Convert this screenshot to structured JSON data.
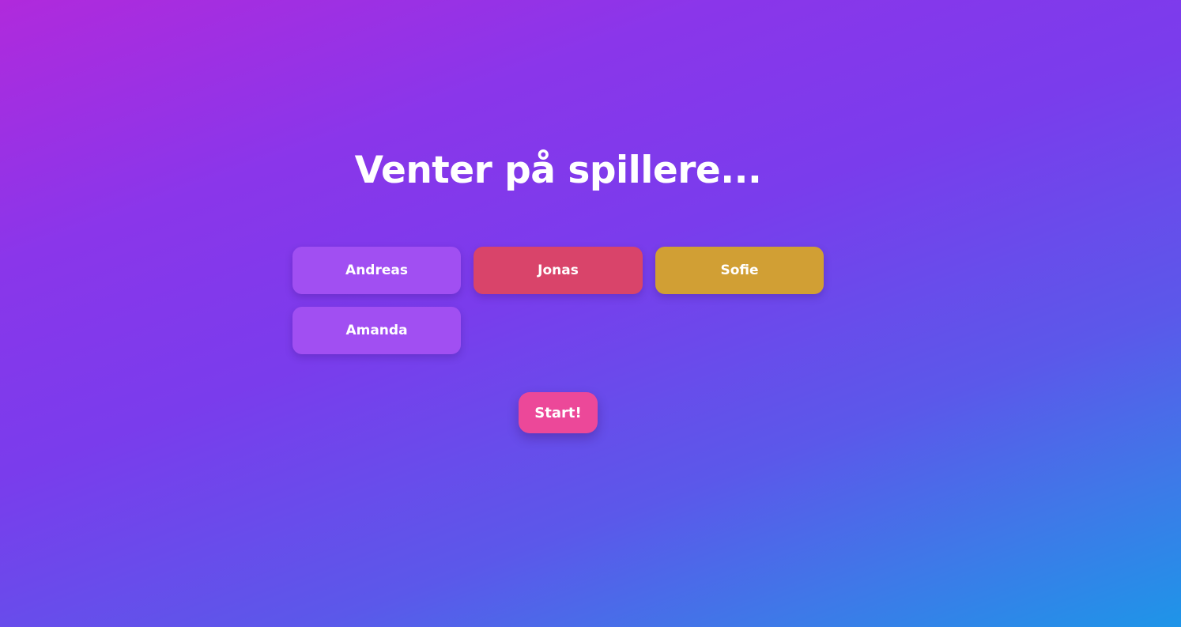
{
  "lobby": {
    "title": "Venter på spillere...",
    "players": [
      {
        "name": "Andreas",
        "color": "#a14ff2"
      },
      {
        "name": "Jonas",
        "color": "#d9446a"
      },
      {
        "name": "Sofie",
        "color": "#d19f34"
      },
      {
        "name": "Amanda",
        "color": "#a14ff2"
      }
    ],
    "start_label": "Start!",
    "start_color": "#ec4899"
  },
  "colors": {
    "gradient_start": "#b02adc",
    "gradient_mid": "#7a3cec",
    "gradient_end": "#1e95e8"
  }
}
